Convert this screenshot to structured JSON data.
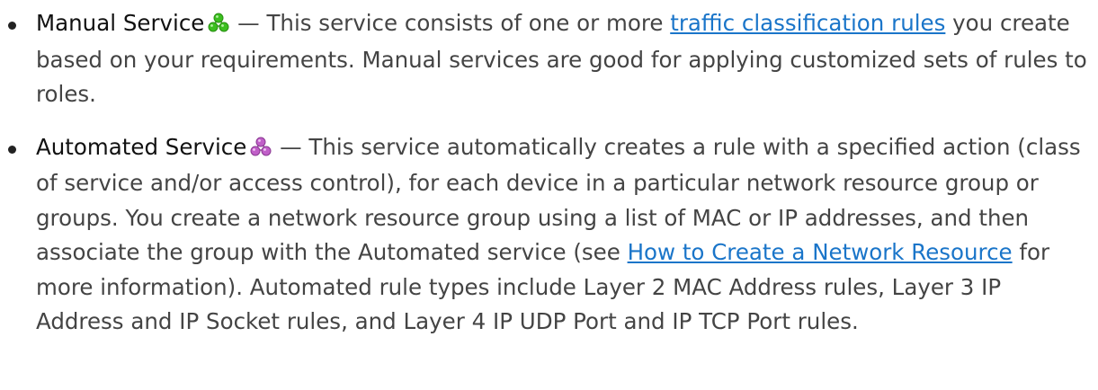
{
  "items": [
    {
      "term": "Manual Service",
      "icon": "manual-service-icon",
      "icon_color": "#3bbf1f",
      "pre_link": " — This service consists of one or more ",
      "link_text": "traffic classification rules",
      "post_link": " you create based on your requirements. Manual services are good for applying customized sets of rules to roles."
    },
    {
      "term": "Automated Service",
      "icon": "automated-service-icon",
      "icon_color": "#c05fc8",
      "pre_link": " — This service automatically creates a rule with a specified action (class of service and/or access control), for each device in a particular network resource group or groups. You create a network resource group using a list of MAC or IP addresses, and then associate the group with the Automated service (see ",
      "link_text": "How to Create a Network Resource",
      "post_link": " for more information). Automated rule types include Layer 2 MAC Address rules, Layer 3 IP Address and IP Socket rules, and Layer 4 IP UDP Port and IP TCP Port rules."
    }
  ],
  "colors": {
    "text": "#444444",
    "term": "#111111",
    "link": "#1a75c9"
  }
}
